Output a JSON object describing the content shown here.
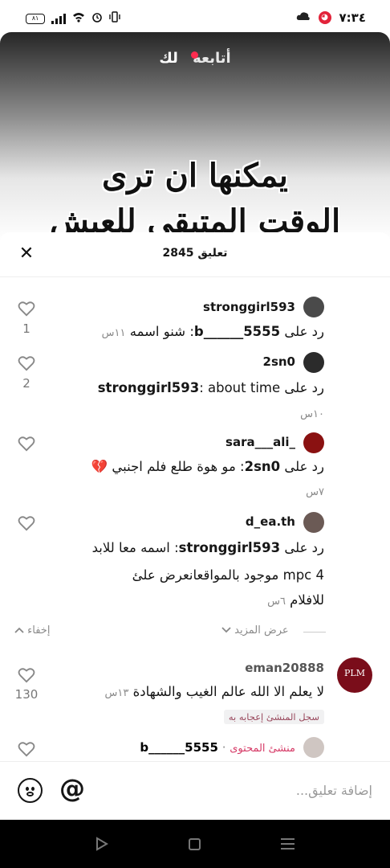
{
  "status_bar": {
    "time": "٧:٣٤",
    "battery": "٨١"
  },
  "video": {
    "tab_following": "أتابعه",
    "tab_for_you": "لك",
    "caption_line1": "يمكنها ان ترى",
    "caption_line2": "الوقت المتبقي للعيش"
  },
  "sheet": {
    "count": "2845",
    "title_word": "تعليق"
  },
  "comments": [
    {
      "username": "stronggirl593",
      "reply_prefix": "رد على",
      "reply_to": "b______5555",
      "text": ": شنو اسمه",
      "time": "١١س",
      "likes": "1"
    },
    {
      "username": "2sn0",
      "reply_prefix": "رد على",
      "reply_to": "stronggirl593",
      "text": ": about time",
      "time": "١٠س",
      "likes": "2"
    },
    {
      "username": "sara___ali_",
      "reply_prefix": "رد على",
      "reply_to": "2sn0",
      "text": ": مو هوة طلع فلم اجنبي 💔",
      "time": "٧س",
      "likes": ""
    },
    {
      "username": "d_ea.th",
      "reply_prefix": "رد على",
      "reply_to": "stronggirl593",
      "text": ": اسمه معا للابد",
      "text_line2": "mpc 4 موجود بالمواقعانعرض علئ",
      "text_line3": "للافلام",
      "time": "٦س",
      "likes": ""
    }
  ],
  "thread_controls": {
    "show_more": "عرض المزيد",
    "hide": "إخفاء"
  },
  "top_comment": {
    "username": "eman20888",
    "avatar_text": "PLM",
    "text": "لا يعلم الا الله عالم الغيب والشهادة",
    "time": "١٣س",
    "likes": "130",
    "creator_liked": "سجل المنشئ إعجابه به"
  },
  "creator_reply": {
    "username": "b______5555",
    "separator": "·",
    "creator_label": "منشئ المحتوى"
  },
  "input": {
    "placeholder": "إضافة تعليق..."
  },
  "icons": [
    "heart-icon",
    "close-icon",
    "emoji-icon",
    "mention-icon",
    "chevron-down-icon",
    "chevron-up-icon",
    "back-icon",
    "home-icon",
    "recents-icon"
  ]
}
